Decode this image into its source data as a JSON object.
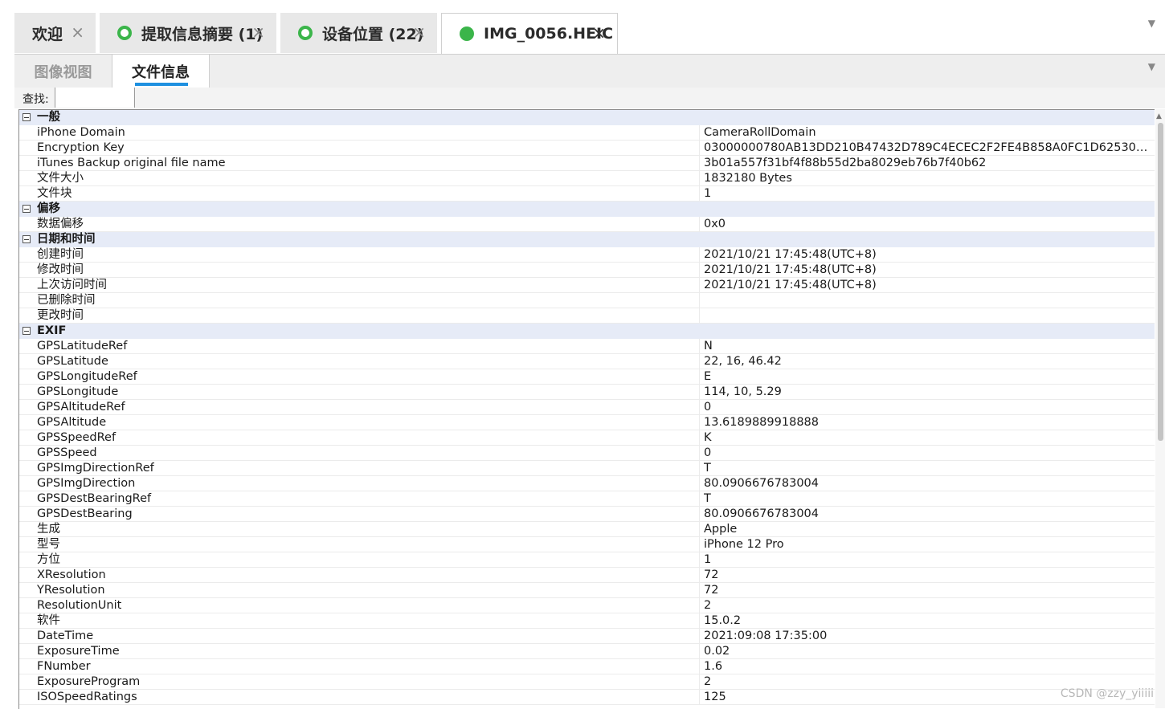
{
  "doc_tabs": [
    {
      "label": "欢迎",
      "status": "none",
      "close": "×"
    },
    {
      "label": "提取信息摘要 (1)",
      "status": "ring",
      "close": "×"
    },
    {
      "label": "设备位置 (22)",
      "status": "ring",
      "close": "×"
    },
    {
      "label": "IMG_0056.HEIC",
      "status": "solid",
      "close": "×",
      "active": true
    }
  ],
  "sub_tabs": [
    {
      "label": "图像视图",
      "active": false
    },
    {
      "label": "文件信息",
      "active": true
    }
  ],
  "search": {
    "label": "查找:",
    "value": ""
  },
  "sections": [
    {
      "title": "一般",
      "rows": [
        {
          "name": "iPhone Domain",
          "value": "CameraRollDomain"
        },
        {
          "name": "Encryption Key",
          "value": "03000000780AB13DD210B47432D789C4ECEC2F2FE4B858A0FC1D6253062..."
        },
        {
          "name": "iTunes Backup original file name",
          "value": "3b01a557f31bf4f88b55d2ba8029eb76b7f40b62"
        },
        {
          "name": "文件大小",
          "value": "1832180 Bytes"
        },
        {
          "name": "文件块",
          "value": "1"
        }
      ]
    },
    {
      "title": "偏移",
      "rows": [
        {
          "name": "数据偏移",
          "value": "0x0"
        }
      ]
    },
    {
      "title": "日期和时间",
      "rows": [
        {
          "name": "创建时间",
          "value": "2021/10/21 17:45:48(UTC+8)"
        },
        {
          "name": "修改时间",
          "value": "2021/10/21 17:45:48(UTC+8)"
        },
        {
          "name": "上次访问时间",
          "value": "2021/10/21 17:45:48(UTC+8)"
        },
        {
          "name": "已删除时间",
          "value": ""
        },
        {
          "name": "更改时间",
          "value": ""
        }
      ]
    },
    {
      "title": "EXIF",
      "rows": [
        {
          "name": "GPSLatitudeRef",
          "value": "N"
        },
        {
          "name": "GPSLatitude",
          "value": "22, 16, 46.42"
        },
        {
          "name": "GPSLongitudeRef",
          "value": "E"
        },
        {
          "name": "GPSLongitude",
          "value": "114, 10, 5.29"
        },
        {
          "name": "GPSAltitudeRef",
          "value": "0"
        },
        {
          "name": "GPSAltitude",
          "value": "13.6189889918888"
        },
        {
          "name": "GPSSpeedRef",
          "value": "K"
        },
        {
          "name": "GPSSpeed",
          "value": "0"
        },
        {
          "name": "GPSImgDirectionRef",
          "value": "T"
        },
        {
          "name": "GPSImgDirection",
          "value": "80.0906676783004"
        },
        {
          "name": "GPSDestBearingRef",
          "value": "T"
        },
        {
          "name": "GPSDestBearing",
          "value": "80.0906676783004"
        },
        {
          "name": "生成",
          "value": "Apple"
        },
        {
          "name": "型号",
          "value": "iPhone 12 Pro"
        },
        {
          "name": "方位",
          "value": "1"
        },
        {
          "name": "XResolution",
          "value": "72"
        },
        {
          "name": "YResolution",
          "value": "72"
        },
        {
          "name": "ResolutionUnit",
          "value": "2"
        },
        {
          "name": "软件",
          "value": "15.0.2"
        },
        {
          "name": "DateTime",
          "value": "2021:09:08 17:35:00"
        },
        {
          "name": "ExposureTime",
          "value": "0.02"
        },
        {
          "name": "FNumber",
          "value": "1.6"
        },
        {
          "name": "ExposureProgram",
          "value": "2"
        },
        {
          "name": "ISOSpeedRatings",
          "value": "125"
        }
      ]
    }
  ],
  "watermark": "CSDN @zzy_yiiiii",
  "icons": {
    "tabs_menu": "chevron-down-icon",
    "section_toggle": "collapse-minus-icon",
    "scroll_up": "arrow-up-icon"
  },
  "colors": {
    "status_green": "#3bb54a",
    "tab_underline": "#1e90e0",
    "section_bg": "#e6ebf7"
  }
}
